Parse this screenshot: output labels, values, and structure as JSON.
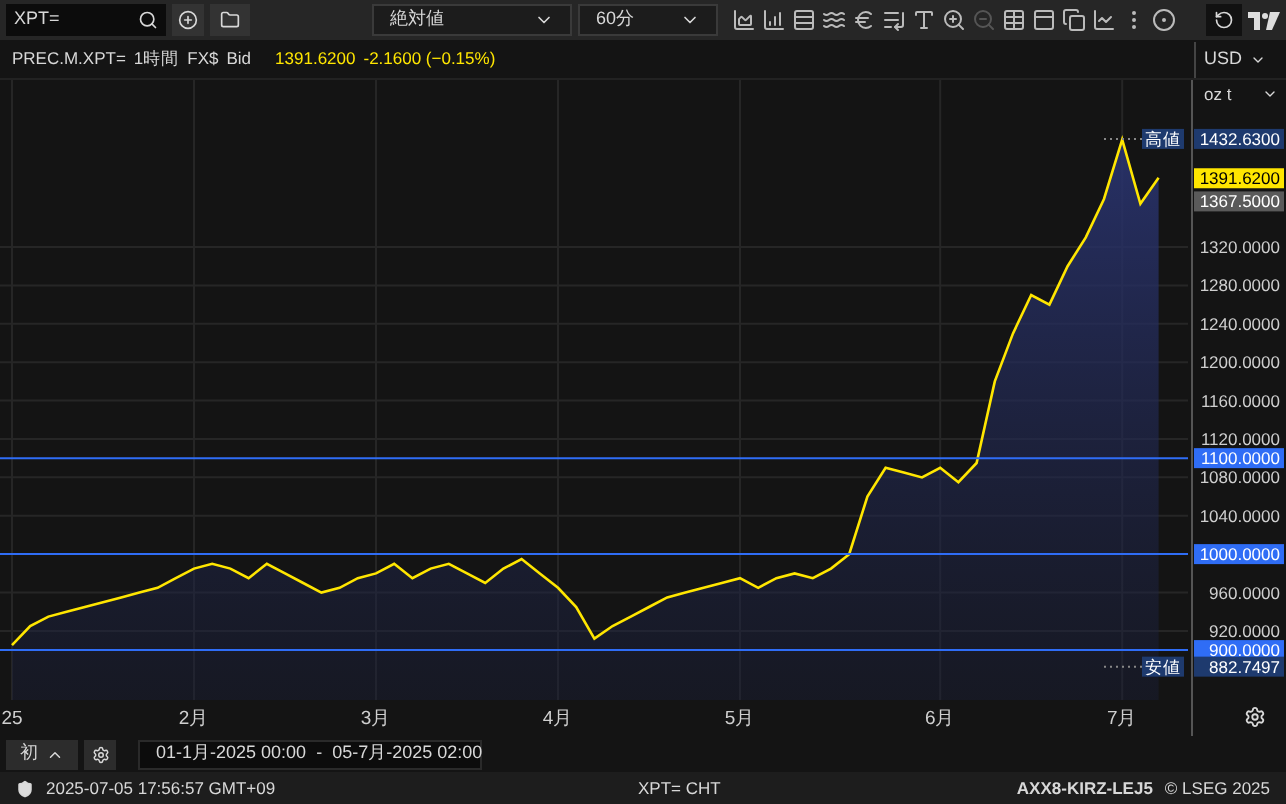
{
  "toolbar": {
    "search": {
      "value": "XPT="
    },
    "dropdowns": [
      {
        "value": "絶対値"
      },
      {
        "value": "60分"
      }
    ]
  },
  "info": {
    "symbol": "PREC.M.XPT=",
    "interval": "1時間",
    "currency": "FX$",
    "side": "Bid",
    "price": "1391.6200",
    "change": "-2.1600 (−0.15%)"
  },
  "axis_controls": {
    "currency": "USD",
    "unit": "oz t"
  },
  "chart": {
    "chart_data": {
      "type": "area",
      "ylim": [
        848,
        1494
      ],
      "grid": true,
      "ref_lines": [
        {
          "axis": "y",
          "value": 1100,
          "label": "1100.0000"
        },
        {
          "axis": "y",
          "value": 1000,
          "label": "1000.0000"
        },
        {
          "axis": "y",
          "value": 900,
          "label": "900.0000"
        }
      ],
      "categories": [
        "25",
        null,
        null,
        null,
        null,
        null,
        null,
        null,
        null,
        null,
        "2月",
        null,
        null,
        null,
        null,
        null,
        null,
        null,
        null,
        null,
        "3月",
        null,
        null,
        null,
        null,
        null,
        null,
        null,
        null,
        null,
        "4月",
        null,
        null,
        null,
        null,
        null,
        null,
        null,
        null,
        null,
        "5月",
        null,
        null,
        null,
        null,
        null,
        null,
        null,
        null,
        null,
        null,
        "6月",
        null,
        null,
        null,
        null,
        null,
        null,
        null,
        null,
        null,
        "7月",
        null,
        null
      ],
      "yticks": [
        {
          "value": 920,
          "label": "920.0000"
        },
        {
          "value": 960,
          "label": "960.0000"
        },
        {
          "value": 1040,
          "label": "1040.0000"
        },
        {
          "value": 1080,
          "label": "1080.0000"
        },
        {
          "value": 1120,
          "label": "1120.0000"
        },
        {
          "value": 1160,
          "label": "1160.0000"
        },
        {
          "value": 1200,
          "label": "1200.0000"
        },
        {
          "value": 1240,
          "label": "1240.0000"
        },
        {
          "value": 1280,
          "label": "1280.0000"
        },
        {
          "value": 1320,
          "label": "1320.0000"
        }
      ],
      "series": [
        {
          "color": "#ffe600",
          "values": [
            905,
            925,
            935,
            940,
            945,
            950,
            955,
            960,
            965,
            975,
            985,
            990,
            985,
            975,
            990,
            980,
            970,
            960,
            965,
            975,
            980,
            990,
            975,
            985,
            990,
            980,
            970,
            985,
            995,
            980,
            965,
            945,
            912,
            925,
            935,
            945,
            955,
            960,
            965,
            970,
            975,
            965,
            975,
            980,
            975,
            985,
            1000,
            1060,
            1090,
            1085,
            1080,
            1090,
            1075,
            1095,
            1180,
            1230,
            1270,
            1260,
            1300,
            1330,
            1370,
            1432,
            1365,
            1392
          ]
        }
      ]
    },
    "price_tags": [
      {
        "kind": "high",
        "name": "高値",
        "label": "1432.6300"
      },
      {
        "kind": "last",
        "label": "1391.6200"
      },
      {
        "kind": "previous",
        "label": "1367.5000"
      },
      {
        "kind": "low",
        "name": "安値",
        "label": "882.7497"
      }
    ]
  },
  "range": {
    "button": "初",
    "start": "01-1月-2025 00:00",
    "separator": "-",
    "end": "05-7月-2025 02:00"
  },
  "status_bar": {
    "time": "2025-07-05 17:56:57 GMT+09",
    "ric": "XPT= CHT",
    "code": "AXX8-KIRZ-LEJ5",
    "copyright": "© LSEG 2025"
  }
}
